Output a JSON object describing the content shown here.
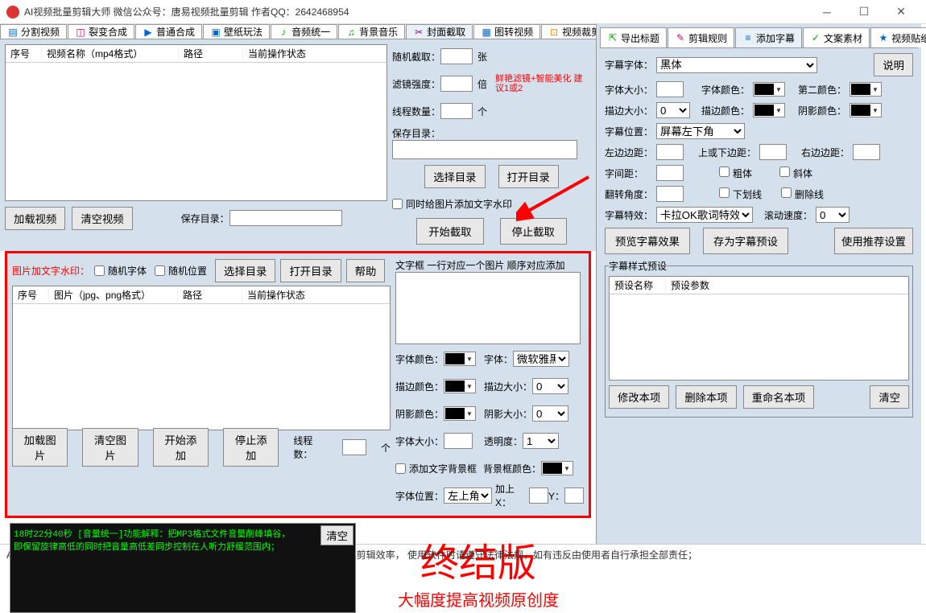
{
  "title": "AI视频批量剪辑大师    微信公众号：唐易视频批量剪辑    作者QQ：2642468954",
  "tabs_left": [
    "分割视频",
    "裂变合成",
    "普通合成",
    "壁纸玩法",
    "音频统一",
    "背景音乐",
    "封面截取",
    "图转视频",
    "视频裁剪"
  ],
  "tabs_right": [
    "导出标题",
    "剪辑规则",
    "添加字幕",
    "文案素材",
    "视频贴纸"
  ],
  "table1_headers": {
    "c1": "序号",
    "c2": "视频名称（mp4格式）",
    "c3": "路径",
    "c4": "当前操作状态"
  },
  "btn_load_video": "加载视频",
  "btn_clear_video": "清空视频",
  "lbl_save_dir": "保存目录：",
  "cover": {
    "random_cut": "随机截取：",
    "unit_zhang": "张",
    "filter_strength": "滤镜强度：",
    "unit_bei": "倍",
    "filter_hint": "鲜艳滤镜+智能美化 建议1或2",
    "threads": "线程数量：",
    "unit_ge": "个",
    "save_dir": "保存目录：",
    "btn_choose_dir": "选择目录",
    "btn_open_dir": "打开目录",
    "chk_watermark": "同时给图片添加文字水印",
    "btn_start": "开始截取",
    "btn_stop": "停止截取"
  },
  "wm": {
    "title": "图片加文字水印：",
    "chk_random_font": "随机字体",
    "chk_random_pos": "随机位置",
    "btn_choose": "选择目录",
    "btn_open": "打开目录",
    "btn_help": "帮助",
    "headers": {
      "c1": "序号",
      "c2": "图片（jpg、png格式）",
      "c3": "路径",
      "c4": "当前操作状态"
    },
    "btn_load": "加载图片",
    "btn_clear": "清空图片",
    "btn_start": "开始添加",
    "btn_stop": "停止添加",
    "threads": "线程数：",
    "unit": "个"
  },
  "textframe": {
    "title": "文字框 一行对应一个图片 顺序对应添加",
    "font_color": "字体颜色：",
    "font": "字体：",
    "font_val": "微软雅黑",
    "stroke_color": "描边颜色：",
    "stroke_size": "描边大小：",
    "stroke_val": "0",
    "shadow_color": "阴影颜色：",
    "shadow_size": "阴影大小：",
    "shadow_val": "0",
    "font_size": "字体大小：",
    "opacity": "透明度：",
    "opacity_val": "1",
    "chk_bgframe": "添加文字背景框",
    "bg_color": "背景框颜色：",
    "font_pos": "字体位置：",
    "font_pos_val": "左上角",
    "add_x": "加上X：",
    "y": "Y："
  },
  "log": {
    "line1": "18时22分40秒 [音量统一]功能解释：把MP3格式文件音量削峰填谷，",
    "line2": "      即保留旋律高低的同时把音量高低差同步控制在人听力舒缓范围内；",
    "clear": "清空"
  },
  "banner": {
    "l1": "终结版",
    "l2": "大幅度提高视频原创度"
  },
  "footer": "AI视频批量剪辑大师是一款视频全自动剪辑软件，  仅用于个人原创视频制作、提高剪辑效率，  使用软件时请遵守法律法规，如有违反由使用者自行承担全部责任；",
  "subtitle": {
    "btn_explain": "说明",
    "font": "字幕字体：",
    "font_val": "黑体",
    "size": "字体大小：",
    "color": "字体颜色：",
    "color2": "第二颜色：",
    "stroke_size": "描边大小：",
    "stroke_val": "0",
    "stroke_color": "描边颜色：",
    "shadow_color": "阴影颜色：",
    "pos": "字幕位置：",
    "pos_val": "屏幕左下角",
    "left_margin": "左边边距：",
    "top_margin": "上或下边距：",
    "right_margin": "右边边距：",
    "spacing": "字间距：",
    "chk_bold": "粗体",
    "chk_italic": "斜体",
    "rotate": "翻转角度：",
    "chk_underline": "下划线",
    "chk_strike": "删除线",
    "effect": "字幕特效：",
    "effect_val": "卡拉OK歌词特效",
    "scroll_speed": "滚动速度：",
    "scroll_val": "0",
    "btn_preview": "预览字幕效果",
    "btn_save_preset": "存为字幕预设",
    "btn_use_preset": "使用推荐设置",
    "preset_title": "字幕样式预设",
    "preset_h1": "预设名称",
    "preset_h2": "预设参数",
    "btn_mod": "修改本项",
    "btn_del": "删除本项",
    "btn_rename": "重命名本项",
    "btn_clear": "清空"
  }
}
